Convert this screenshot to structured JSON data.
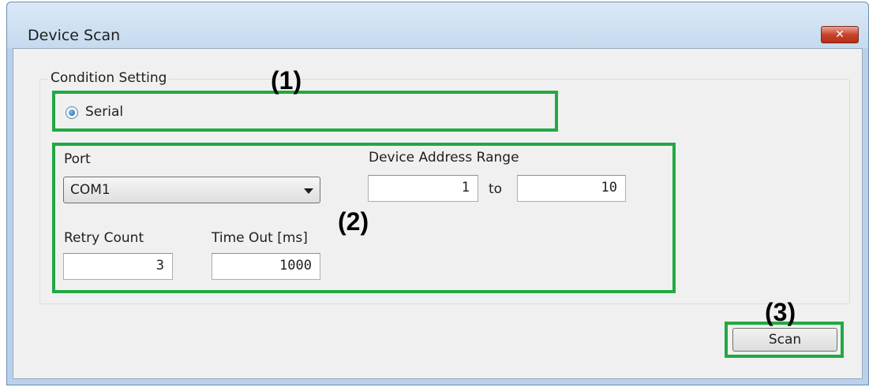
{
  "window": {
    "title": "Device Scan",
    "close_glyph": "✕"
  },
  "condition_group": {
    "legend": "Condition Setting",
    "serial_label": "Serial",
    "serial_selected": true
  },
  "port": {
    "label": "Port",
    "selected_value": "COM1"
  },
  "address_range": {
    "label": "Device Address Range",
    "from_value": "1",
    "to_label": "to",
    "to_value": "10"
  },
  "retry": {
    "label": "Retry Count",
    "value": "3"
  },
  "timeout": {
    "label": "Time Out [ms]",
    "value": "1000"
  },
  "buttons": {
    "scan_label": "Scan"
  },
  "callouts": {
    "c1": "(1)",
    "c2": "(2)",
    "c3": "(3)",
    "color": "#21a942"
  }
}
